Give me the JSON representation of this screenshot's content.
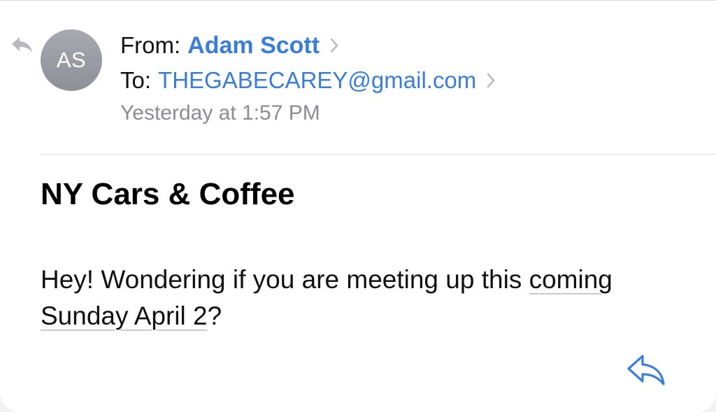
{
  "header": {
    "avatar_initials": "AS",
    "from_label": "From:",
    "sender_name": "Adam Scott",
    "to_label": "To:",
    "recipient_email": "THEGABECAREY@gmail.com",
    "date": "Yesterday at 1:57 PM"
  },
  "message": {
    "subject": "NY Cars & Coffee",
    "body_prefix": "Hey! Wondering if you are meeting up this ",
    "body_detected_date": "coming Sunday April 2",
    "body_suffix": "?"
  },
  "icons": {
    "replied_indicator": "reply-arrow-icon",
    "sender_chevron": "chevron-right-icon",
    "recipient_chevron": "chevron-right-icon",
    "reply_button": "reply-icon"
  },
  "colors": {
    "link_blue": "#3a7fd5",
    "secondary_gray": "#8c8c91",
    "avatar_gray": "#9b9da4",
    "divider": "#d9d9dd"
  }
}
